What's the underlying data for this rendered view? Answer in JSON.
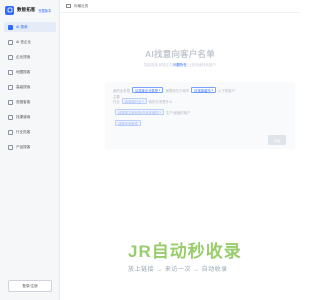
{
  "app": {
    "name": "数智拓客",
    "badge": "完整版本"
  },
  "sidebar": {
    "items": [
      {
        "label": "AI 搜索",
        "active": true
      },
      {
        "label": "AI 查企业",
        "active": false
      },
      {
        "label": "企业搜索",
        "active": false
      },
      {
        "label": "地图搜客",
        "active": false
      },
      {
        "label": "高级搜索",
        "active": false
      },
      {
        "label": "查圈客客",
        "active": false
      },
      {
        "label": "找渠道商",
        "active": false
      },
      {
        "label": "行业拓客",
        "active": false
      },
      {
        "label": "产品搜客",
        "active": false
      }
    ],
    "login_label": "登录/注册"
  },
  "topbar": {
    "label": "你最近的"
  },
  "main": {
    "title": "AI找意向客户名单",
    "subtitle_before": "智能搜索,精准定位",
    "subtitle_highlight": "问题所在",
    "subtitle_after": ",让你快速找到客户"
  },
  "form": {
    "line1_before": "我的业务是",
    "chip1": "请选择企业类型",
    "line1_mid": "我想找位于城市",
    "chip2": "请选择城市",
    "line1_after": "以下的客户",
    "line2_prefix": "主要",
    "line2_before": "行业",
    "chip3": "请选择行业",
    "line2_after": "我的业务是什么",
    "chip4": "请选择主营业务/产品关键词",
    "line3_after": "生产/经营的客户",
    "chip5": "请填写关键词",
    "submit_label": "查询"
  },
  "watermark": {
    "brand": "JR自动秒收录",
    "slogan": "放上链接 → 来访一次 → 自动收录"
  },
  "colors": {
    "accent": "#2f6bff",
    "watermark_green": "#8cc85a"
  }
}
